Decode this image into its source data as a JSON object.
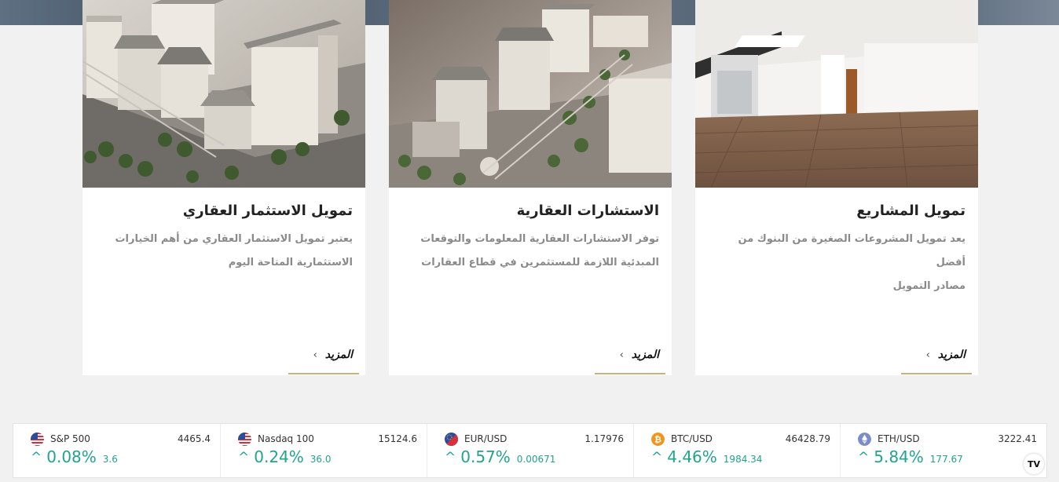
{
  "cards": [
    {
      "title": "تمويل الاستثمار العقاري",
      "desc_line1": "يعتبر تمويل الاستثمار العقاري من أهم الخيارات",
      "desc_line2": "الاستثمارية المتاحة اليوم",
      "more": "المزيد",
      "image": "building-model-image"
    },
    {
      "title": "الاستشارات العقارية",
      "desc_line1": "توفر الاستشارات العقارية المعلومات والتوقعات",
      "desc_line2": "المبدئية اللازمة للمستثمرين في قطاع العقارات",
      "more": "المزيد",
      "image": "city-model-image"
    },
    {
      "title": "تمويل المشاريع",
      "desc_line1": "يعد تمويل المشروعات الصغيرة من البنوك من أفضل",
      "desc_line2": "مصادر التمويل",
      "more": "المزيد",
      "image": "empty-room-image"
    }
  ],
  "ticker": [
    {
      "name": "S&P 500",
      "price": "4465.4",
      "pct": "0.08%",
      "change": "3.6",
      "icon": "us-flag-icon"
    },
    {
      "name": "Nasdaq 100",
      "price": "15124.6",
      "pct": "0.24%",
      "change": "36.0",
      "icon": "us-flag-icon"
    },
    {
      "name": "EUR/USD",
      "price": "1.17976",
      "pct": "0.57%",
      "change": "0.00671",
      "icon": "eur-usd-icon"
    },
    {
      "name": "BTC/USD",
      "price": "46428.79",
      "pct": "4.46%",
      "change": "1984.34",
      "icon": "bitcoin-icon"
    },
    {
      "name": "ETH/USD",
      "price": "3222.41",
      "pct": "5.84%",
      "change": "177.67",
      "icon": "ethereum-icon"
    }
  ],
  "ticker_arrow": "^",
  "tv_logo": "TV",
  "colors": {
    "positive": "#22a38d",
    "accent_line": "#c9b27c"
  }
}
